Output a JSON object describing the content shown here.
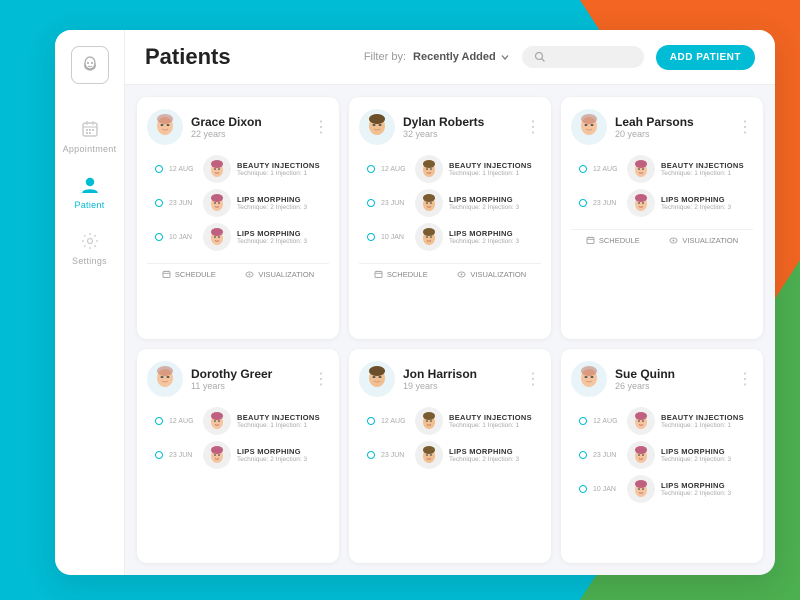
{
  "background": {
    "orange_color": "#f26522",
    "green_color": "#4caf50",
    "cyan_color": "#00bcd4"
  },
  "sidebar": {
    "logo_label": "face-logo",
    "items": [
      {
        "id": "appointment",
        "label": "Appointment",
        "active": false,
        "icon": "calendar-icon"
      },
      {
        "id": "patient",
        "label": "Patient",
        "active": true,
        "icon": "patient-icon"
      },
      {
        "id": "settings",
        "label": "Settings",
        "active": false,
        "icon": "settings-icon"
      }
    ]
  },
  "header": {
    "title": "Patients",
    "filter_label": "Filter by:",
    "filter_value": "Recently Added",
    "search_placeholder": "",
    "add_button": "ADD PATIENT"
  },
  "patients": [
    {
      "id": "grace-dixon",
      "name": "Grace Dixon",
      "age": "22 years",
      "treatments": [
        {
          "date": "12 AUG",
          "name": "BEAUTY INJECTIONS",
          "detail": "Technique: 1  Injection: 1"
        },
        {
          "date": "23 JUN",
          "name": "LIPS MORPHING",
          "detail": "Technique: 2  Injection: 3"
        },
        {
          "date": "10 JAN",
          "name": "LIPS MORPHING",
          "detail": "Technique: 2  Injection: 3"
        }
      ],
      "actions": [
        "SCHEDULE",
        "VISUALIZATION"
      ]
    },
    {
      "id": "dylan-roberts",
      "name": "Dylan Roberts",
      "age": "32 years",
      "treatments": [
        {
          "date": "12 AUG",
          "name": "BEAUTY INJECTIONS",
          "detail": "Technique: 1  Injection: 1"
        },
        {
          "date": "23 JUN",
          "name": "LIPS MORPHING",
          "detail": "Technique: 2  Injection: 3"
        },
        {
          "date": "10 JAN",
          "name": "LIPS MORPHING",
          "detail": "Technique: 2  Injection: 3"
        }
      ],
      "actions": [
        "SCHEDULE",
        "VISUALIZATION"
      ]
    },
    {
      "id": "leah-parsons",
      "name": "Leah Parsons",
      "age": "20 years",
      "treatments": [
        {
          "date": "12 AUG",
          "name": "BEAUTY INJECTIONS",
          "detail": "Technique: 1  Injection: 1"
        },
        {
          "date": "23 JUN",
          "name": "LIPS MORPHING",
          "detail": "Technique: 2  Injection: 3"
        }
      ],
      "actions": [
        "SCHEDULE",
        "VISUALIZATION"
      ]
    },
    {
      "id": "dorothy-greer",
      "name": "Dorothy Greer",
      "age": "11 years",
      "treatments": [
        {
          "date": "12 AUG",
          "name": "BEAUTY INJECTIONS",
          "detail": "Technique: 1  Injection: 1"
        },
        {
          "date": "23 JUN",
          "name": "LIPS MORPHING",
          "detail": "Technique: 2  Injection: 3"
        }
      ],
      "actions": []
    },
    {
      "id": "jon-harrison",
      "name": "Jon Harrison",
      "age": "19 years",
      "treatments": [
        {
          "date": "12 AUG",
          "name": "BEAUTY INJECTIONS",
          "detail": "Technique: 1  Injection: 1"
        },
        {
          "date": "23 JUN",
          "name": "LIPS MORPHING",
          "detail": "Technique: 2  Injection: 3"
        }
      ],
      "actions": []
    },
    {
      "id": "sue-quinn",
      "name": "Sue Quinn",
      "age": "26 years",
      "treatments": [
        {
          "date": "12 AUG",
          "name": "BEAUTY INJECTIONS",
          "detail": "Technique: 1  Injection: 1"
        },
        {
          "date": "23 JUN",
          "name": "LIPS MORPHING",
          "detail": "Technique: 2  Injection: 3"
        },
        {
          "date": "10 JAN",
          "name": "LIPS MORPHING",
          "detail": "Technique: 2  Injection: 3"
        }
      ],
      "actions": []
    }
  ]
}
